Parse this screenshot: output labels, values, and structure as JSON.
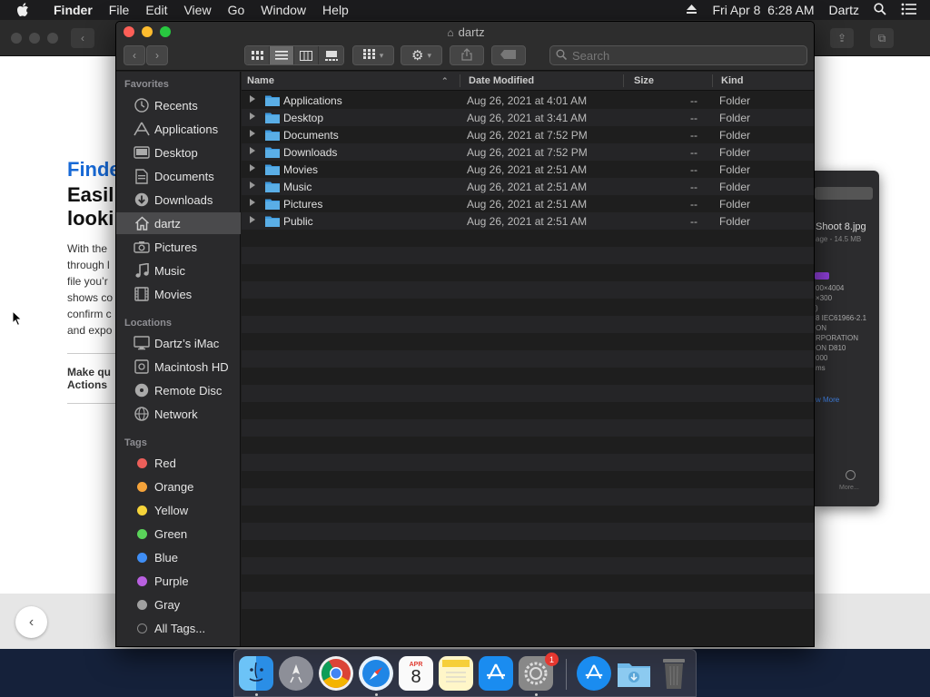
{
  "menubar": {
    "app": "Finder",
    "items": [
      "File",
      "Edit",
      "View",
      "Go",
      "Window",
      "Help"
    ],
    "datetime": "Fri Apr 8  6:28 AM",
    "user": "Dartz"
  },
  "background": {
    "heading_a": "Finde",
    "heading_b": "Easil",
    "heading_c": "looki",
    "para": [
      "With the",
      "through l",
      "file you’r",
      "shows co",
      "confirm c",
      "and expo"
    ],
    "make_a": "Make qu",
    "make_b": "Actions"
  },
  "inspector": {
    "filename": "Shoot 8.jpg",
    "sub": "age - 14.5 MB",
    "meta": [
      "00×4004",
      "×300",
      ")",
      "8 IEC61966-2.1",
      "ON",
      "RPORATION",
      "ON D810",
      "000",
      "ms"
    ],
    "more_link": "w More",
    "more_label": "More..."
  },
  "finder": {
    "title": "dartz",
    "search_placeholder": "Search",
    "sidebar": {
      "favorites_label": "Favorites",
      "favorites": [
        {
          "label": "Recents",
          "icon": "clock-icon"
        },
        {
          "label": "Applications",
          "icon": "applications-icon"
        },
        {
          "label": "Desktop",
          "icon": "desktop-icon"
        },
        {
          "label": "Documents",
          "icon": "document-icon"
        },
        {
          "label": "Downloads",
          "icon": "download-icon"
        },
        {
          "label": "dartz",
          "icon": "home-icon"
        },
        {
          "label": "Pictures",
          "icon": "camera-icon"
        },
        {
          "label": "Music",
          "icon": "music-icon"
        },
        {
          "label": "Movies",
          "icon": "film-icon"
        }
      ],
      "locations_label": "Locations",
      "locations": [
        {
          "label": "Dartz’s iMac",
          "icon": "imac-icon"
        },
        {
          "label": "Macintosh HD",
          "icon": "disk-icon"
        },
        {
          "label": "Remote Disc",
          "icon": "disc-icon"
        },
        {
          "label": "Network",
          "icon": "globe-icon"
        }
      ],
      "tags_label": "Tags",
      "tags": [
        {
          "label": "Red",
          "color": "#ec5f5a"
        },
        {
          "label": "Orange",
          "color": "#f5a33a"
        },
        {
          "label": "Yellow",
          "color": "#f6d43a"
        },
        {
          "label": "Green",
          "color": "#5ad35a"
        },
        {
          "label": "Blue",
          "color": "#3f8ef5"
        },
        {
          "label": "Purple",
          "color": "#b960e0"
        },
        {
          "label": "Gray",
          "color": "#a0a0a0"
        },
        {
          "label": "All Tags...",
          "color": "transparent"
        }
      ]
    },
    "columns": {
      "name": "Name",
      "date": "Date Modified",
      "size": "Size",
      "kind": "Kind"
    },
    "files": [
      {
        "name": "Applications",
        "date": "Aug 26, 2021 at 4:01 AM",
        "size": "--",
        "kind": "Folder"
      },
      {
        "name": "Desktop",
        "date": "Aug 26, 2021 at 3:41 AM",
        "size": "--",
        "kind": "Folder"
      },
      {
        "name": "Documents",
        "date": "Aug 26, 2021 at 7:52 PM",
        "size": "--",
        "kind": "Folder"
      },
      {
        "name": "Downloads",
        "date": "Aug 26, 2021 at 7:52 PM",
        "size": "--",
        "kind": "Folder"
      },
      {
        "name": "Movies",
        "date": "Aug 26, 2021 at 2:51 AM",
        "size": "--",
        "kind": "Folder"
      },
      {
        "name": "Music",
        "date": "Aug 26, 2021 at 2:51 AM",
        "size": "--",
        "kind": "Folder"
      },
      {
        "name": "Pictures",
        "date": "Aug 26, 2021 at 2:51 AM",
        "size": "--",
        "kind": "Folder"
      },
      {
        "name": "Public",
        "date": "Aug 26, 2021 at 2:51 AM",
        "size": "--",
        "kind": "Folder"
      }
    ]
  },
  "dock": {
    "apps": [
      "finder",
      "launchpad",
      "chrome",
      "safari",
      "calendar",
      "notes",
      "app-store",
      "system-preferences",
      "app-store-download",
      "downloads-folder",
      "trash"
    ],
    "calendar_month": "APR",
    "calendar_day": "8",
    "prefs_badge": "1"
  },
  "colors": {
    "accent": "#3f8ef5",
    "folder": "#5aaee6"
  }
}
